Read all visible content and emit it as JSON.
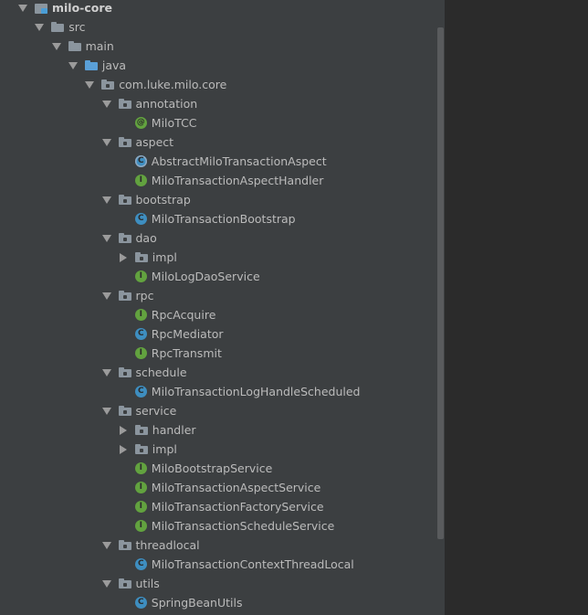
{
  "tree": [
    {
      "label": "milo-core",
      "depth": 0,
      "arrow": "down",
      "icon": "module",
      "bold": true
    },
    {
      "label": "src",
      "depth": 1,
      "arrow": "down",
      "icon": "folder"
    },
    {
      "label": "main",
      "depth": 2,
      "arrow": "down",
      "icon": "folder"
    },
    {
      "label": "java",
      "depth": 3,
      "arrow": "down",
      "icon": "folder-blue"
    },
    {
      "label": "com.luke.milo.core",
      "depth": 4,
      "arrow": "down",
      "icon": "package"
    },
    {
      "label": "annotation",
      "depth": 5,
      "arrow": "down",
      "icon": "package"
    },
    {
      "label": "MiloTCC",
      "depth": 6,
      "arrow": "none",
      "icon": "annotation",
      "badge": "@"
    },
    {
      "label": "aspect",
      "depth": 5,
      "arrow": "down",
      "icon": "package"
    },
    {
      "label": "AbstractMiloTransactionAspect",
      "depth": 6,
      "arrow": "none",
      "icon": "abstract-class",
      "badge": "C"
    },
    {
      "label": "MiloTransactionAspectHandler",
      "depth": 6,
      "arrow": "none",
      "icon": "interface",
      "badge": "I"
    },
    {
      "label": "bootstrap",
      "depth": 5,
      "arrow": "down",
      "icon": "package"
    },
    {
      "label": "MiloTransactionBootstrap",
      "depth": 6,
      "arrow": "none",
      "icon": "class",
      "badge": "C"
    },
    {
      "label": "dao",
      "depth": 5,
      "arrow": "down",
      "icon": "package"
    },
    {
      "label": "impl",
      "depth": 6,
      "arrow": "right",
      "icon": "package"
    },
    {
      "label": "MiloLogDaoService",
      "depth": 6,
      "arrow": "none",
      "icon": "interface",
      "badge": "I"
    },
    {
      "label": "rpc",
      "depth": 5,
      "arrow": "down",
      "icon": "package"
    },
    {
      "label": "RpcAcquire",
      "depth": 6,
      "arrow": "none",
      "icon": "interface",
      "badge": "I"
    },
    {
      "label": "RpcMediator",
      "depth": 6,
      "arrow": "none",
      "icon": "class",
      "badge": "C"
    },
    {
      "label": "RpcTransmit",
      "depth": 6,
      "arrow": "none",
      "icon": "interface",
      "badge": "I"
    },
    {
      "label": "schedule",
      "depth": 5,
      "arrow": "down",
      "icon": "package"
    },
    {
      "label": "MiloTransactionLogHandleScheduled",
      "depth": 6,
      "arrow": "none",
      "icon": "class",
      "badge": "C"
    },
    {
      "label": "service",
      "depth": 5,
      "arrow": "down",
      "icon": "package"
    },
    {
      "label": "handler",
      "depth": 6,
      "arrow": "right",
      "icon": "package"
    },
    {
      "label": "impl",
      "depth": 6,
      "arrow": "right",
      "icon": "package"
    },
    {
      "label": "MiloBootstrapService",
      "depth": 6,
      "arrow": "none",
      "icon": "interface",
      "badge": "I"
    },
    {
      "label": "MiloTransactionAspectService",
      "depth": 6,
      "arrow": "none",
      "icon": "interface",
      "badge": "I"
    },
    {
      "label": "MiloTransactionFactoryService",
      "depth": 6,
      "arrow": "none",
      "icon": "interface",
      "badge": "I"
    },
    {
      "label": "MiloTransactionScheduleService",
      "depth": 6,
      "arrow": "none",
      "icon": "interface",
      "badge": "I"
    },
    {
      "label": "threadlocal",
      "depth": 5,
      "arrow": "down",
      "icon": "package"
    },
    {
      "label": "MiloTransactionContextThreadLocal",
      "depth": 6,
      "arrow": "none",
      "icon": "class",
      "badge": "C"
    },
    {
      "label": "utils",
      "depth": 5,
      "arrow": "down",
      "icon": "package"
    },
    {
      "label": "SpringBeanUtils",
      "depth": 6,
      "arrow": "none",
      "icon": "class",
      "badge": "C"
    }
  ],
  "colors": {
    "panel": "#3c3f41",
    "editor": "#2b2b2b",
    "class": "#3e8ec0",
    "interface": "#62a23f"
  }
}
